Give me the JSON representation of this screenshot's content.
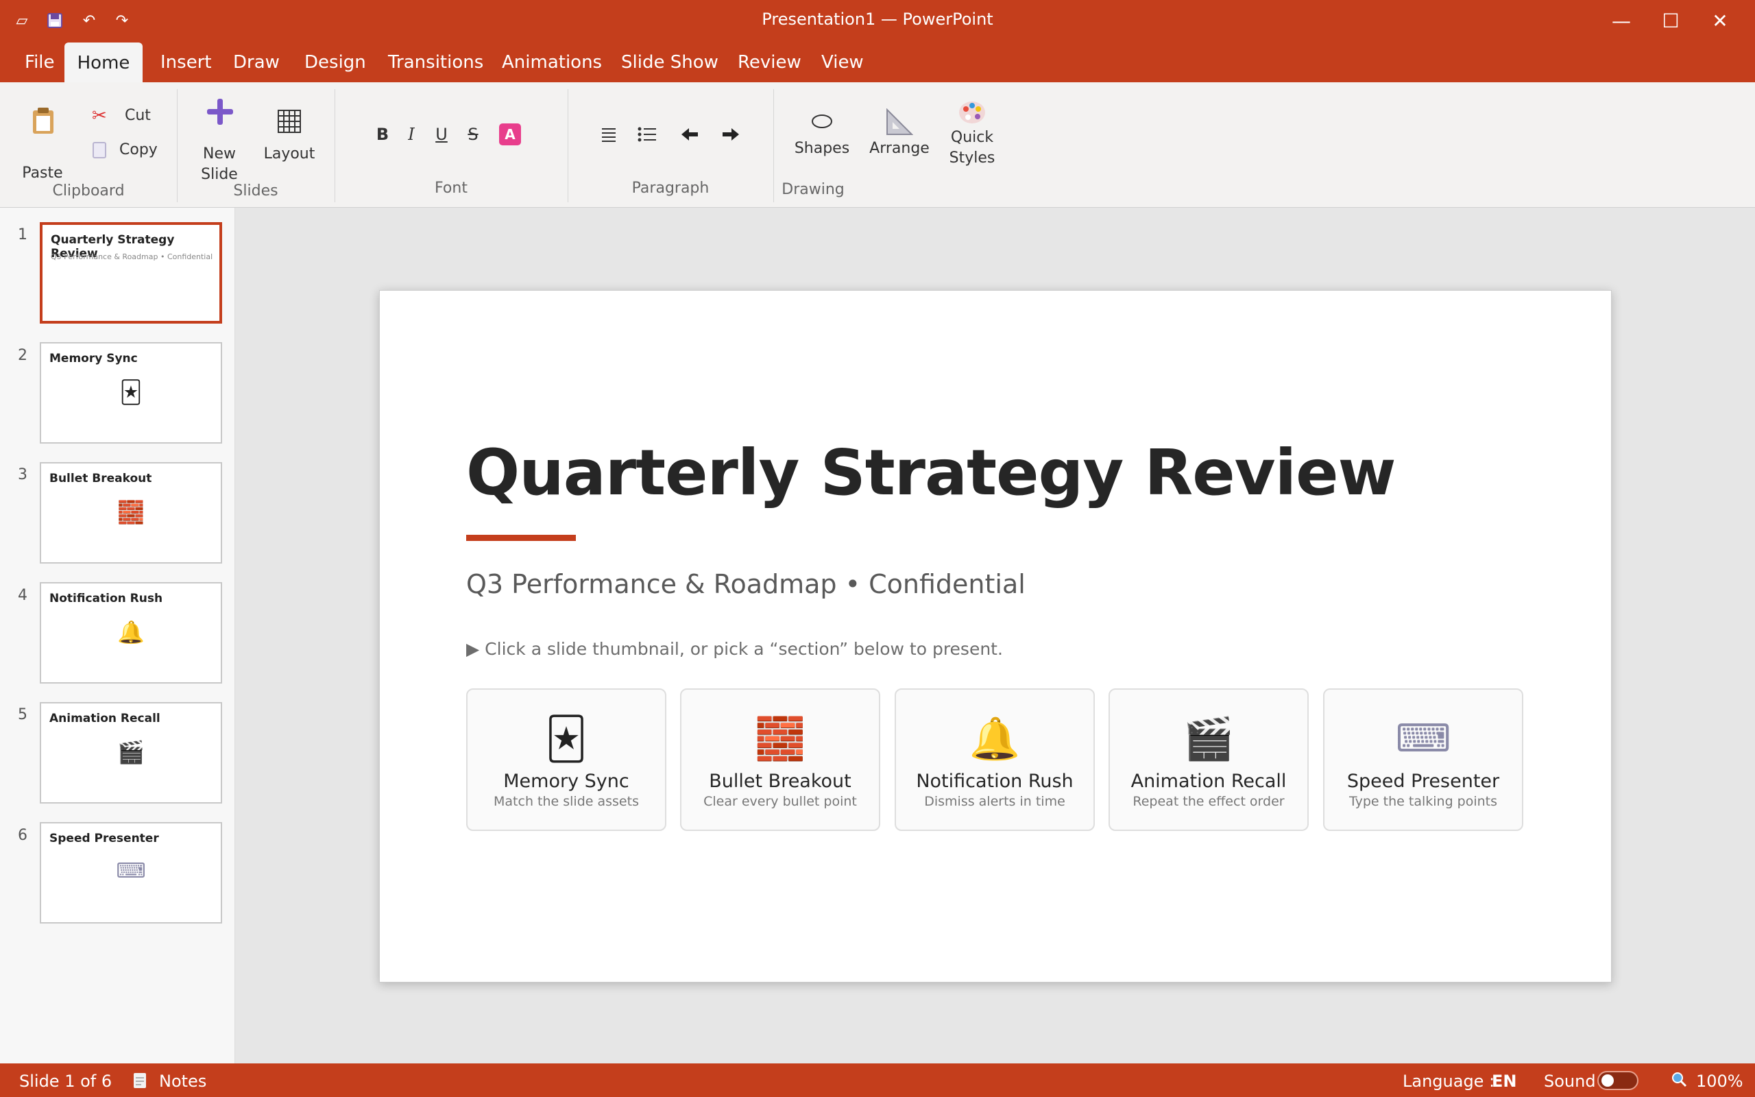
{
  "app": {
    "title": "Presentation1 — PowerPoint",
    "accent": "#c43e1c"
  },
  "quick_access": [
    {
      "icon": "presentation-frame-icon",
      "glyph": "▱"
    },
    {
      "icon": "save-icon",
      "glyph": "💾"
    },
    {
      "icon": "undo-icon",
      "glyph": "↶"
    },
    {
      "icon": "redo-icon",
      "glyph": "↷"
    }
  ],
  "window_controls": {
    "minimize": "—",
    "maximize": "☐",
    "close": "✕"
  },
  "tabs": [
    "File",
    "Home",
    "Insert",
    "Draw",
    "Design",
    "Transitions",
    "Animations",
    "Slide Show",
    "Review",
    "View"
  ],
  "active_tab": "Home",
  "ribbon": {
    "clipboard": {
      "paste": "Paste",
      "cut": "Cut",
      "copy": "Copy",
      "label": "Clipboard"
    },
    "slides": {
      "new_slide_line1": "New",
      "new_slide_line2": "Slide",
      "layout": "Layout",
      "label": "Slides"
    },
    "font": {
      "bold": "B",
      "italic": "I",
      "underline": "U",
      "strike": "S",
      "color": "A",
      "label": "Font"
    },
    "paragraph": {
      "label": "Paragraph"
    },
    "drawing": {
      "shapes": "Shapes",
      "arrange": "Arrange",
      "quick_line1": "Quick",
      "quick_line2": "Styles",
      "label": "Drawing"
    }
  },
  "thumbnails": [
    {
      "num": "1",
      "title": "Quarterly Strategy Review",
      "sub": "Q3 Performance & Roadmap • Confidential",
      "icon": ""
    },
    {
      "num": "2",
      "title": "Memory Sync",
      "sub": "",
      "icon": "🃏"
    },
    {
      "num": "3",
      "title": "Bullet Breakout",
      "sub": "",
      "icon": "🧱"
    },
    {
      "num": "4",
      "title": "Notification Rush",
      "sub": "",
      "icon": "🔔"
    },
    {
      "num": "5",
      "title": "Animation Recall",
      "sub": "",
      "icon": "🎬"
    },
    {
      "num": "6",
      "title": "Speed Presenter",
      "sub": "",
      "icon": "⌨"
    }
  ],
  "slide": {
    "title": "Quarterly Strategy Review",
    "subtitle": "Q3 Performance & Roadmap • Confidential",
    "hint": "▶ Click a slide thumbnail, or pick a “section” below to present.",
    "cards": [
      {
        "icon": "🃏",
        "title": "Memory Sync",
        "desc": "Match the slide assets"
      },
      {
        "icon": "🧱",
        "title": "Bullet Breakout",
        "desc": "Clear every bullet point"
      },
      {
        "icon": "🔔",
        "title": "Notification Rush",
        "desc": "Dismiss alerts in time"
      },
      {
        "icon": "🎬",
        "title": "Animation Recall",
        "desc": "Repeat the effect order"
      },
      {
        "icon": "⌨",
        "title": "Speed Presenter",
        "desc": "Type the talking points"
      }
    ]
  },
  "status": {
    "slide_info": "Slide 1 of 6",
    "notes": "Notes",
    "language_label": "Language :",
    "language_value": "EN",
    "sound": "Sound",
    "sound_on": false,
    "zoom": "100%"
  }
}
